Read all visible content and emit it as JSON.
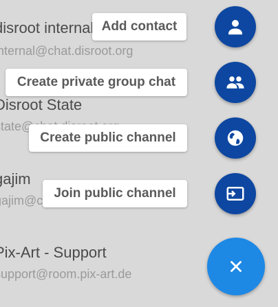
{
  "contacts": [
    {
      "name": "disroot internal",
      "address": "internal@chat.disroot.org"
    },
    {
      "name": "Disroot State",
      "address": "state@chat.disroot.org"
    },
    {
      "name": "gajim",
      "address": "gajim@conference.gajim.org"
    },
    {
      "name": "Pix-Art - Support",
      "address": "support@room.pix-art.de"
    }
  ],
  "speed_dial": {
    "add_contact": "Add contact",
    "create_private_group_chat": "Create private group chat",
    "create_public_channel": "Create public channel",
    "join_public_channel": "Join public channel",
    "close_icon": "close-icon"
  },
  "colors": {
    "mini_fab": "#0d47a1",
    "main_fab": "#1e88e5",
    "scrim": "#d9d9d9"
  }
}
